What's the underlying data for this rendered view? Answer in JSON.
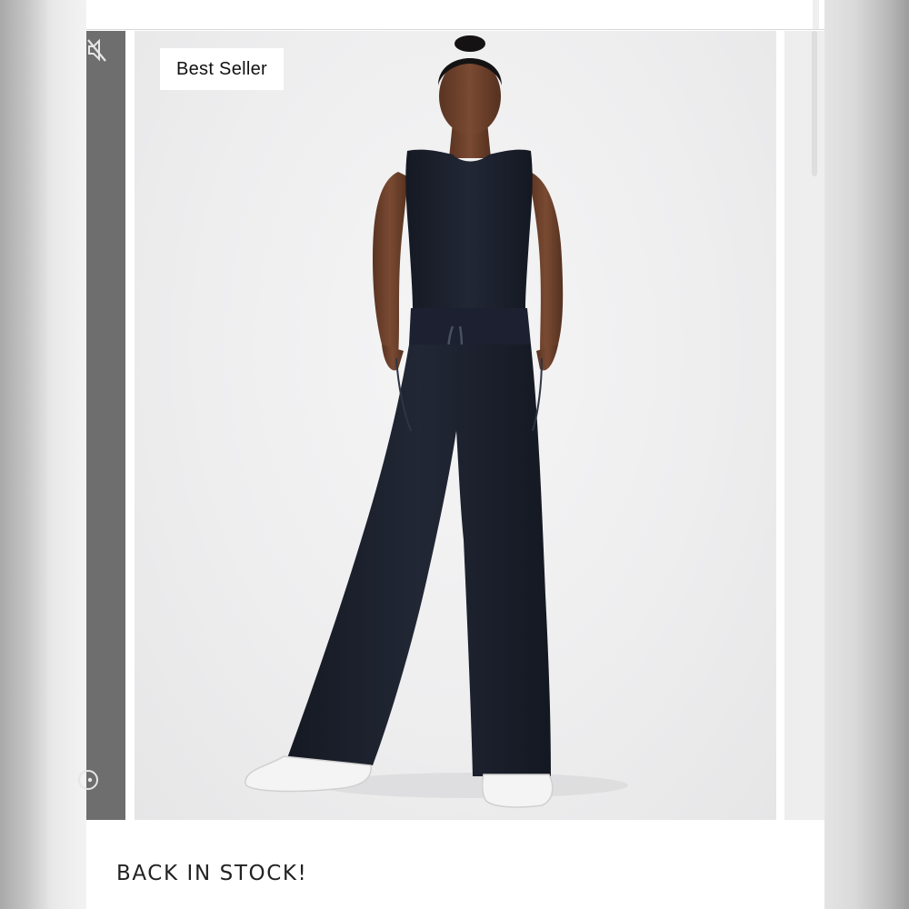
{
  "product": {
    "badge": "Best Seller",
    "caption": "BACK IN STOCK!",
    "image_subject": "model in black sleeveless top and wide-leg drawstring pants with white sneakers"
  },
  "controls": {
    "mute_icon": "mute-icon",
    "play_icon": "play-icon"
  },
  "colors": {
    "badge_bg": "#ffffff",
    "photo_bg": "#eeeeef",
    "garment": "#1b1f2a",
    "prev_slide": "#6e6e6e"
  }
}
